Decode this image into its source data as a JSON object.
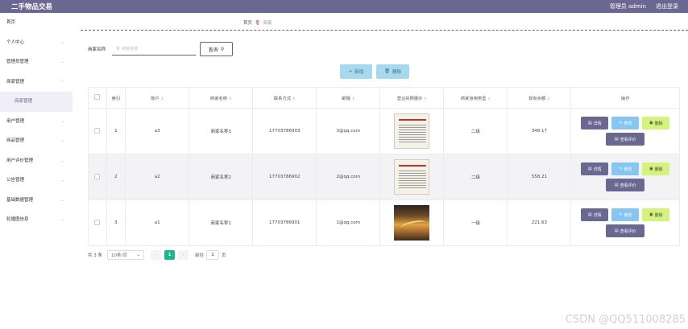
{
  "header": {
    "title": "二手物品交易",
    "user_label": "管理员 admin",
    "logout_label": "退出登录",
    "bg_color": "#6a6791"
  },
  "sidebar": {
    "items": [
      {
        "label": "首页",
        "chevron": ""
      },
      {
        "label": "个人中心",
        "chevron": "⌄"
      },
      {
        "label": "管理员管理",
        "chevron": "⌄"
      },
      {
        "label": "商家管理",
        "chevron": "⌃"
      },
      {
        "label": "商家管理",
        "chevron": "",
        "sub": true
      },
      {
        "label": "用户管理",
        "chevron": "⌄"
      },
      {
        "label": "商品管理",
        "chevron": "⌄"
      },
      {
        "label": "用户评价管理",
        "chevron": "⌄"
      },
      {
        "label": "公告管理",
        "chevron": "⌄"
      },
      {
        "label": "基础数据管理",
        "chevron": "⌄"
      },
      {
        "label": "轮播图信息",
        "chevron": "⌄"
      }
    ]
  },
  "breadcrumb": {
    "home": "首页",
    "current": "商家"
  },
  "search": {
    "label": "商家名称",
    "placeholder": "商家名称",
    "query_label": "查询"
  },
  "actions": {
    "add_label": "新增",
    "delete_label": "删除"
  },
  "table": {
    "columns": [
      "索引",
      "账户",
      "商家名称",
      "联系方式",
      "邮箱",
      "营业执照展示",
      "商家信用类型",
      "现有余额",
      "操作"
    ],
    "rows": [
      {
        "index": "1",
        "account": "a3",
        "name": "商家名称3",
        "phone": "17703786903",
        "email": "3@qq.com",
        "image": "cert",
        "credit": "二级",
        "balance": "348.17"
      },
      {
        "index": "2",
        "account": "a2",
        "name": "商家名称2",
        "phone": "17703786902",
        "email": "2@qq.com",
        "image": "cert",
        "credit": "二级",
        "balance": "558.21"
      },
      {
        "index": "3",
        "account": "a1",
        "name": "商家名称1",
        "phone": "17703786901",
        "email": "1@qq.com",
        "image": "photo",
        "credit": "一级",
        "balance": "221.63"
      }
    ],
    "row_actions": {
      "detail": "详情",
      "edit": "修改",
      "remove": "删除",
      "rate": "查看评价"
    }
  },
  "pagination": {
    "total": "共 3 条",
    "page_size": "10条/页",
    "current_page": "1",
    "goto_label": "前往",
    "goto_value": "1",
    "page_unit": "页"
  },
  "watermark": "CSDN @QQ511008285"
}
